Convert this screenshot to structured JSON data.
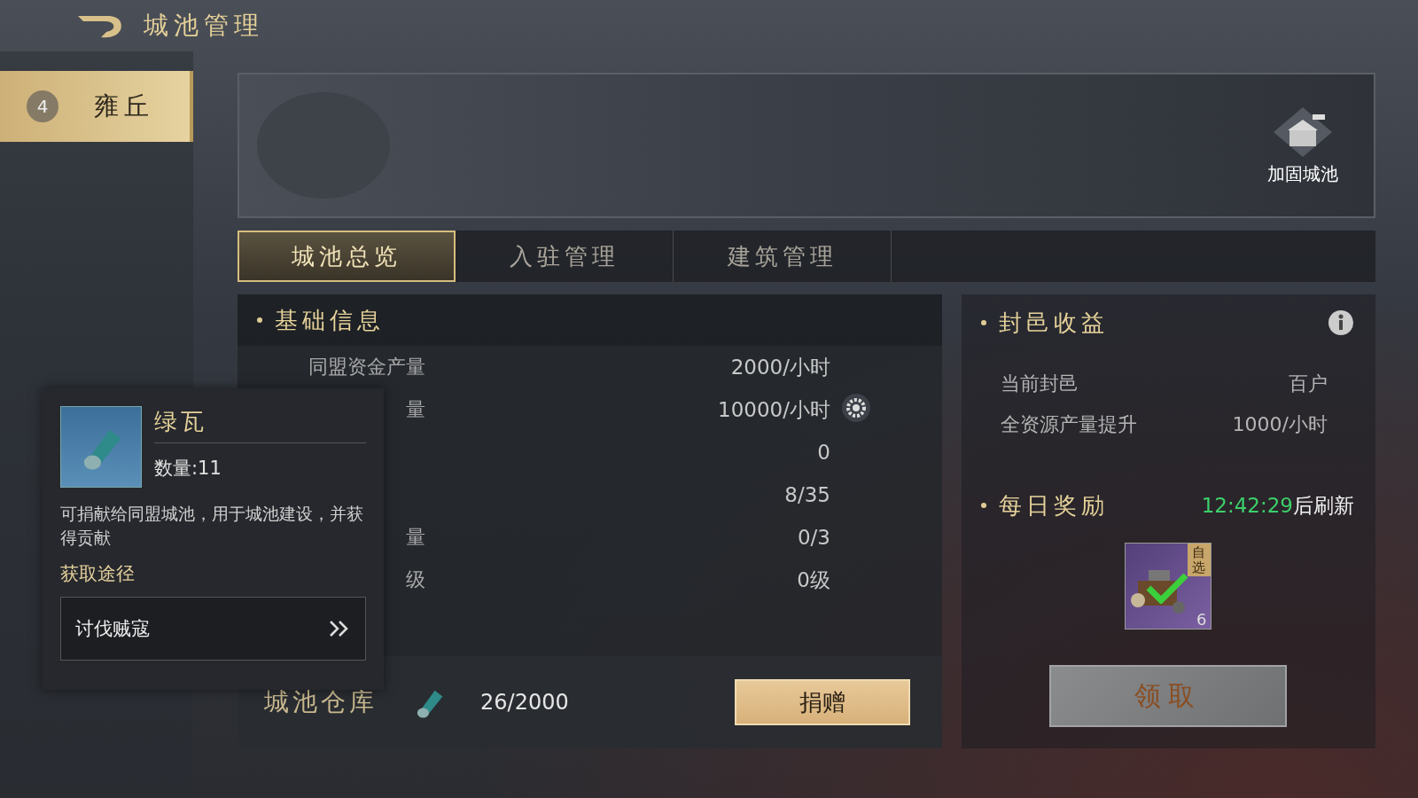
{
  "header": {
    "title": "城池管理"
  },
  "sidebar": {
    "items": [
      {
        "badge": "4",
        "label": "雍丘",
        "selected": true
      }
    ]
  },
  "banner": {
    "action": "加固城池"
  },
  "tabs": [
    {
      "label": "城池总览",
      "selected": true
    },
    {
      "label": "入驻管理",
      "selected": false
    },
    {
      "label": "建筑管理",
      "selected": false
    }
  ],
  "basic_info": {
    "title": "基础信息",
    "rows": [
      {
        "label": "同盟资金产量",
        "value": "2000/小时"
      },
      {
        "label": "量",
        "value": "10000/小时",
        "gear": true
      },
      {
        "value": "0"
      },
      {
        "value": "8/35"
      },
      {
        "label": "量",
        "value": "0/3"
      },
      {
        "label": "级",
        "value": "0级"
      }
    ],
    "storage": {
      "label": "城池仓库",
      "amount": "26/2000",
      "button": "捐赠"
    }
  },
  "fief": {
    "title": "封邑收益",
    "rows": [
      {
        "label": "当前封邑",
        "value": "百户"
      },
      {
        "label": "全资源产量提升",
        "value": "1000/小时"
      }
    ]
  },
  "daily": {
    "title": "每日奖励",
    "timer": "12:42:29",
    "timer_suffix": "后刷新",
    "reward": {
      "tag": "自选",
      "count": "6",
      "claimed": true
    },
    "button": "领取"
  },
  "popup": {
    "name": "绿瓦",
    "quantity": "数量:11",
    "description": "可捐献给同盟城池，用于城池建设，并获得贡献",
    "source_title": "获取途径",
    "sources": [
      "讨伐贼寇"
    ]
  }
}
